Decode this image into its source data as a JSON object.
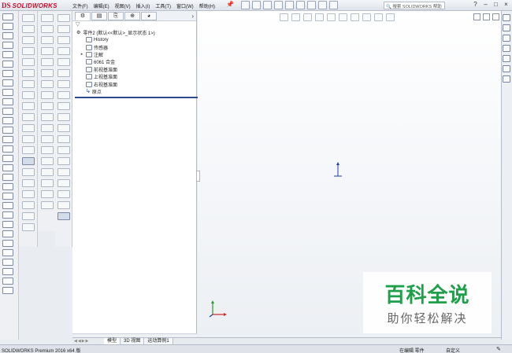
{
  "app": {
    "logo_mark": "DS",
    "logo_text": "SOLIDWORKS",
    "menu": [
      "文件(F)",
      "编辑(E)",
      "视图(V)",
      "插入(I)",
      "工具(T)",
      "窗口(W)",
      "帮助(H)"
    ],
    "search_placeholder": "搜索 SOLIDWORKS 帮助"
  },
  "feature_manager": {
    "tabs": [
      "feature-manager-tab",
      "property-manager-tab",
      "configuration-manager-tab",
      "dimxpert-tab",
      "display-manager-tab"
    ],
    "filter_icon": "funnel-icon",
    "root": "零件2 (默认<<默认>_显示状态 1>)",
    "items": [
      {
        "label": "History",
        "icon": "history-icon",
        "expandable": false
      },
      {
        "label": "传感器",
        "icon": "sensor-icon",
        "expandable": false
      },
      {
        "label": "注解",
        "icon": "annotation-icon",
        "expandable": true
      },
      {
        "label": "6061 合金",
        "icon": "material-icon",
        "expandable": false
      },
      {
        "label": "前视基准面",
        "icon": "plane-icon",
        "expandable": false
      },
      {
        "label": "上视基准面",
        "icon": "plane-icon",
        "expandable": false
      },
      {
        "label": "右视基准面",
        "icon": "plane-icon",
        "expandable": false
      },
      {
        "label": "原点",
        "icon": "origin-icon",
        "expandable": false
      }
    ]
  },
  "bottom_tabs": [
    "模型",
    "3D 视图",
    "运动算例1"
  ],
  "status": {
    "product": "SOLIDWORKS Premium 2016 x64 版",
    "mode": "在编辑 零件",
    "units": "自定义"
  },
  "watermark": {
    "title": "百科全说",
    "subtitle": "助你轻松解决"
  },
  "colors": {
    "brand": "#c8102e",
    "rollback": "#2f4a8f",
    "origin": "#1f3fa0",
    "watermark_green": "#1f9f4a"
  }
}
